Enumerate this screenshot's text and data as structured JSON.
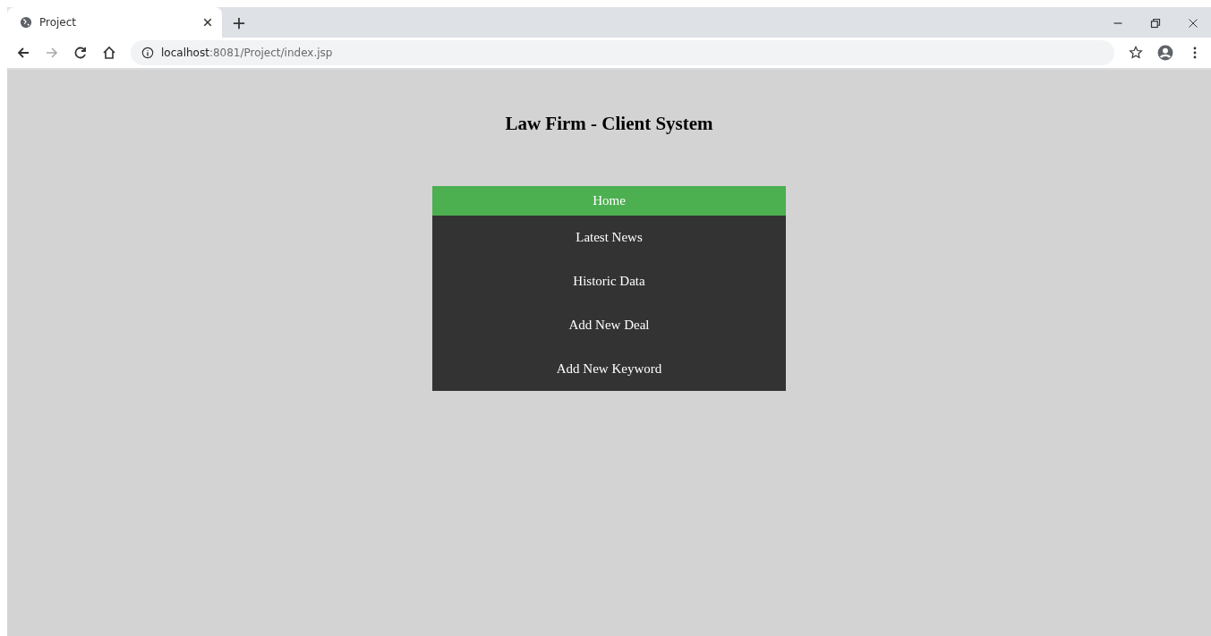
{
  "browser": {
    "tab": {
      "title": "Project"
    },
    "address": {
      "host": "localhost",
      "path": ":8081/Project/index.jsp"
    }
  },
  "page": {
    "title": "Law Firm - Client System",
    "nav": [
      {
        "label": "Home",
        "selected": true
      },
      {
        "label": "Latest News",
        "selected": false
      },
      {
        "label": "Historic Data",
        "selected": false
      },
      {
        "label": "Add New Deal",
        "selected": false
      },
      {
        "label": "Add New Keyword",
        "selected": false
      }
    ]
  }
}
